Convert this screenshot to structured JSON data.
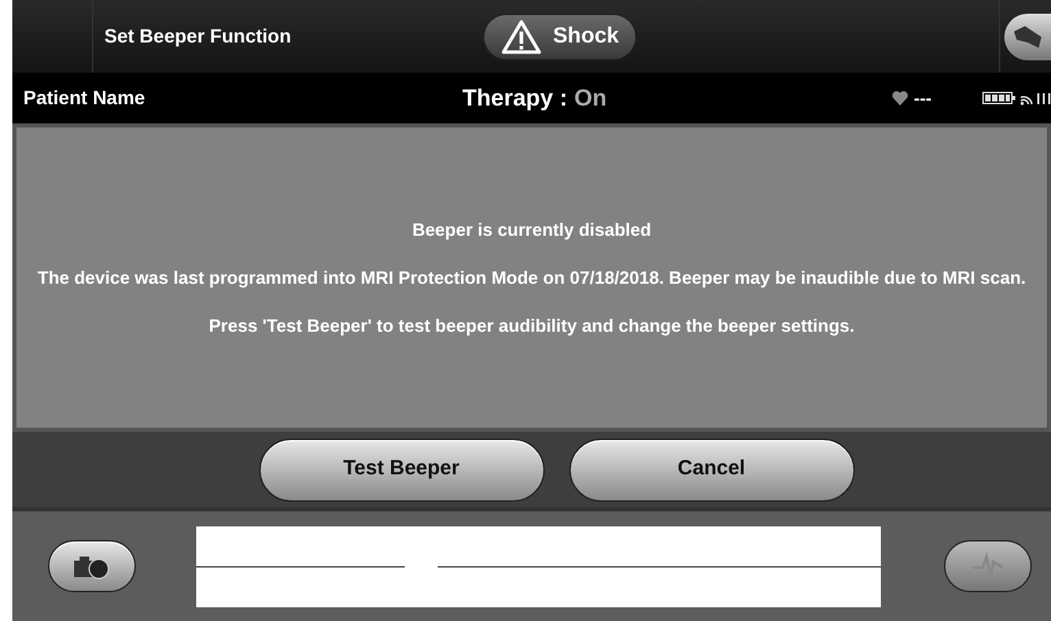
{
  "header": {
    "title": "Set Beeper Function",
    "shock_button": "Shock"
  },
  "status_bar": {
    "patient_name": "Patient Name",
    "therapy_label": "Therapy :",
    "therapy_value": "On",
    "heart_reading": "---"
  },
  "message": {
    "lines": [
      "Beeper is currently disabled",
      "The device was last programmed into MRI Protection Mode on 07/18/2018. Beeper may be inaudible due to MRI scan.",
      "Press 'Test Beeper' to test beeper audibility and change the beeper settings."
    ]
  },
  "buttons": [
    {
      "label": "Test Beeper"
    },
    {
      "label": "Cancel"
    }
  ],
  "footer": {
    "ecg_button": {
      "disabled": true
    }
  }
}
